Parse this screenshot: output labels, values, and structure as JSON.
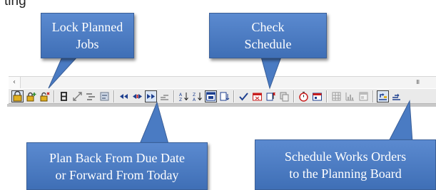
{
  "top_text": "ting",
  "callouts": {
    "lock_planned_jobs": [
      "Lock Planned",
      "Jobs"
    ],
    "check_schedule": [
      "Check",
      "Schedule"
    ],
    "plan_back_forward": [
      "Plan Back From Due Date",
      "or Forward From Today"
    ],
    "schedule_works_orders": [
      "Schedule Works Orders",
      "to the Planning Board"
    ]
  },
  "toolbar_icons": [
    "lock-schedule-icon",
    "lock-add-icon",
    "unlock-icon",
    "hourglass-icon",
    "resize-icon",
    "multi-bars-icon",
    "board-icon",
    "rewind-icon",
    "center-icon",
    "forward-icon",
    "gantt-step-icon",
    "sort-ascending-icon",
    "sort-descending-icon",
    "calendar-select-icon",
    "export-icon",
    "check-icon",
    "calendar-x-icon",
    "flag-icon",
    "copy-icon",
    "stopwatch-icon",
    "calendar-red-icon",
    "grid-icon",
    "chart-icon",
    "window-icon",
    "schedule-board-icon",
    "schedule-list-icon"
  ],
  "scroll_grip_glyph": "III"
}
